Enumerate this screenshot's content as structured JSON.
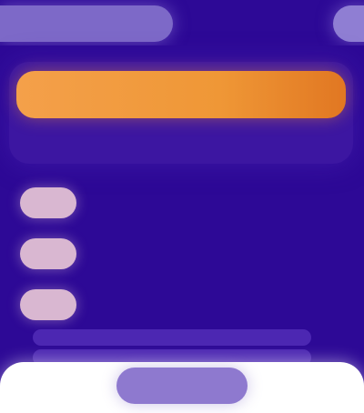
{
  "header": {
    "left_tab": "",
    "right_button": ""
  },
  "banner": {
    "label": ""
  },
  "rows": [
    {
      "text": ""
    },
    {
      "text": ""
    },
    {
      "text": ""
    }
  ],
  "bottom_list": [
    {
      "text": ""
    },
    {
      "text": ""
    },
    {
      "text": ""
    }
  ],
  "footer": {
    "button_label": ""
  },
  "colors": {
    "background": "#2d0996",
    "banner_orange": "#ef9736",
    "pill_lavender": "#7d69c8",
    "row_icon": "#d9b7d1",
    "footer_white": "#ffffff"
  }
}
